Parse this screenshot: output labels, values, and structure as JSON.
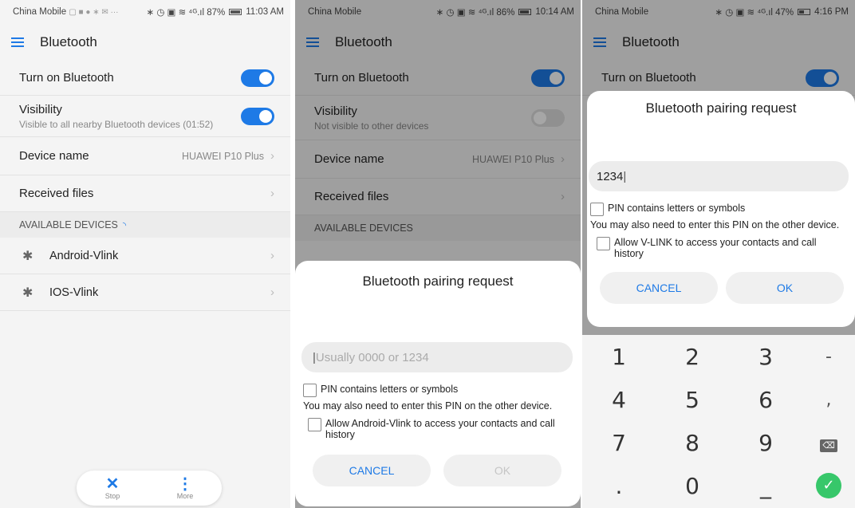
{
  "colors": {
    "accent": "#1e7ae6",
    "toggle_off": "#dddddd",
    "done_green": "#37c76a"
  },
  "panel1": {
    "status": {
      "carrier": "China Mobile",
      "icons": "▢ ■ ● ∗ ✉ ···",
      "signal": "∗ ◷ ▣ ≋ ⁴ᴳ.ıl 87%",
      "time": "11:03 AM"
    },
    "title": "Bluetooth",
    "turn_on_label": "Turn on Bluetooth",
    "visibility_label": "Visibility",
    "visibility_sub": "Visible to all nearby Bluetooth devices (01:52)",
    "device_name_label": "Device name",
    "device_name_value": "HUAWEI P10 Plus",
    "received_files_label": "Received files",
    "section_label": "AVAILABLE DEVICES",
    "devices": [
      {
        "label": "Android-Vlink"
      },
      {
        "label": "IOS-Vlink"
      }
    ],
    "bottom": {
      "stop_label": "Stop",
      "more_label": "More"
    }
  },
  "panel2": {
    "status": {
      "carrier": "China Mobile",
      "signal": "∗ ◷ ▣ ≋ ⁴ᴳ.ıl 86%",
      "time": "10:14 AM"
    },
    "title": "Bluetooth",
    "turn_on_label": "Turn on Bluetooth",
    "visibility_label": "Visibility",
    "visibility_sub": "Not visible to other devices",
    "device_name_label": "Device name",
    "device_name_value": "HUAWEI P10 Plus",
    "received_files_label": "Received files",
    "section_label": "AVAILABLE DEVICES",
    "dialog": {
      "title": "Bluetooth pairing request",
      "pin_placeholder": "Usually 0000 or 1234",
      "pin_letters_label": "PIN contains letters or symbols",
      "note": "You may also need to enter this PIN on the other device.",
      "allow_label": "Allow Android-Vlink to access your contacts and call history",
      "cancel_label": "CANCEL",
      "ok_label": "OK"
    }
  },
  "panel3": {
    "status": {
      "carrier": "China Mobile",
      "signal": "∗ ◷ ▣ ≋ ⁴ᴳ.ıl 47%",
      "time": "4:16 PM"
    },
    "title": "Bluetooth",
    "turn_on_label": "Turn on Bluetooth",
    "dialog": {
      "title": "Bluetooth pairing request",
      "pin_value": "1234",
      "pin_letters_label": "PIN contains letters or symbols",
      "note": "You may also need to enter this PIN on the other device.",
      "allow_label": "Allow V-LINK to access your contacts and call history",
      "cancel_label": "CANCEL",
      "ok_label": "OK"
    },
    "keypad": {
      "rows": [
        [
          "1",
          "2",
          "3",
          "-"
        ],
        [
          "4",
          "5",
          "6",
          ","
        ],
        [
          "7",
          "8",
          "9",
          "⌫"
        ],
        [
          ".",
          "0",
          "_",
          "✓"
        ]
      ]
    }
  }
}
